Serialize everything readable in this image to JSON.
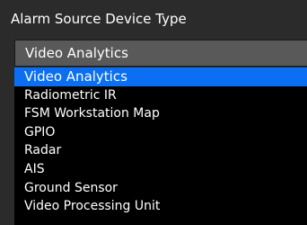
{
  "field": {
    "label": "Alarm Source Device Type"
  },
  "select": {
    "value": "Video Analytics"
  },
  "dropdown": {
    "options": [
      "Video Analytics",
      "Radiometric IR",
      "FSM Workstation Map",
      "GPIO",
      "Radar",
      "AIS",
      "Ground Sensor",
      "Video Processing Unit"
    ],
    "highlighted_option": "Video Analytics"
  },
  "colors": {
    "background": "#2b2b2b",
    "select_background": "#595959",
    "list_background": "#000000",
    "highlight": "#0a6ff2",
    "text": "#ffffff"
  }
}
